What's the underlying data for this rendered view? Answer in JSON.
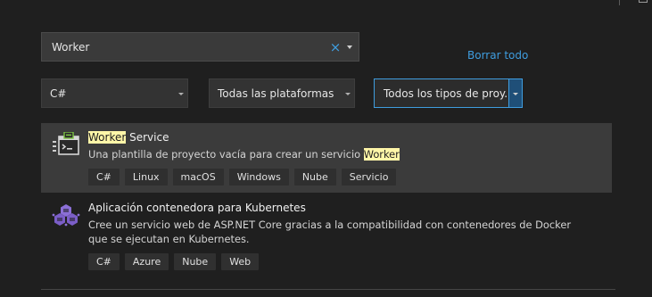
{
  "search": {
    "value": "Worker",
    "clear_glyph": "×"
  },
  "filters": {
    "clear_all_label": "Borrar todo",
    "language": "C#",
    "platform": "Todas las plataformas",
    "project_type": "Todos los tipos de proy..."
  },
  "results": [
    {
      "icon": "worker-service-icon",
      "title_match": "Worker",
      "title_rest": " Service",
      "desc_prefix": "Una plantilla de proyecto vacía para crear un servicio ",
      "desc_match": "Worker",
      "tags": [
        "C#",
        "Linux",
        "macOS",
        "Windows",
        "Nube",
        "Servicio"
      ]
    },
    {
      "icon": "kubernetes-container-icon",
      "title": "Aplicación contenedora para Kubernetes",
      "description": "Cree un servicio web de ASP.NET Core gracias a la compatibilidad con contenedores de Docker que se ejecutan en Kubernetes.",
      "tags": [
        "C#",
        "Azure",
        "Nube",
        "Web"
      ]
    }
  ],
  "colors": {
    "background": "#1f1f1f",
    "accent": "#3f9ddf",
    "highlight": "#fff6a8",
    "selected_row": "#3b3b3b"
  }
}
